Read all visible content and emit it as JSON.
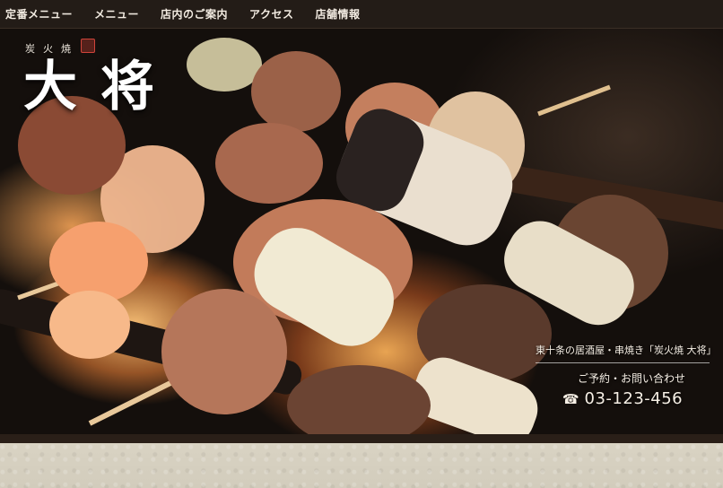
{
  "nav": {
    "items": [
      {
        "label": "定番メニュー"
      },
      {
        "label": "メニュー"
      },
      {
        "label": "店内のご案内"
      },
      {
        "label": "アクセス"
      },
      {
        "label": "店舗情報"
      }
    ]
  },
  "hero": {
    "brand_small": "炭火焼",
    "brand_large": "大将"
  },
  "contact": {
    "tagline": "東十条の居酒屋・串焼き「炭火焼 大将」",
    "reserve_label": "ご予約・お問い合わせ",
    "phone_icon": "phone-icon",
    "phone": "03-123-456"
  },
  "colors": {
    "nav_bg": "#231c17",
    "accent_seal": "#d0443a",
    "paper": "#d6d0c0"
  }
}
